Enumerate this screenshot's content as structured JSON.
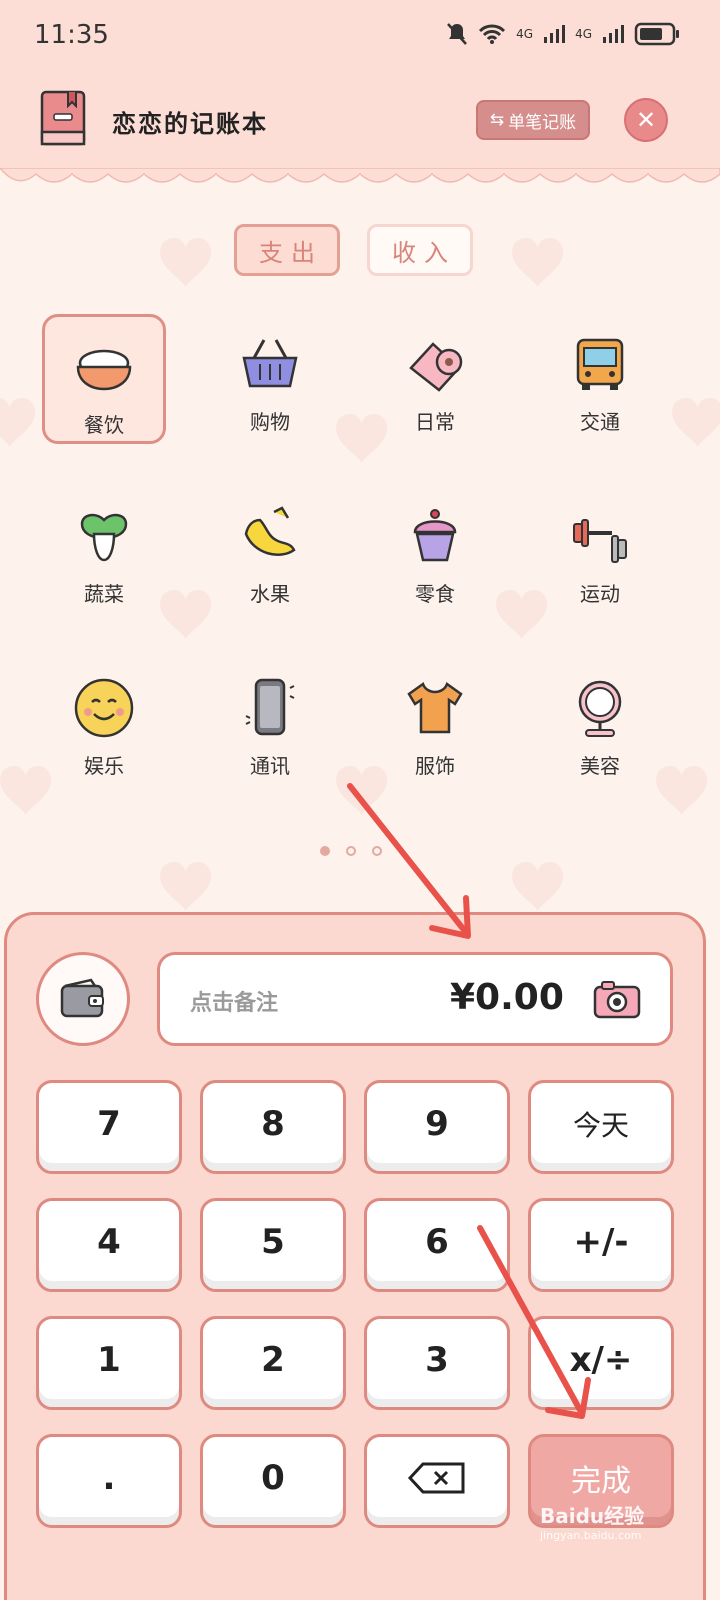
{
  "status_bar": {
    "time": "11:35",
    "signal_1": "4G",
    "signal_2": "4G"
  },
  "header": {
    "title": "恋恋的记账本",
    "single_button": "单笔记账",
    "single_icon": "swap-icon",
    "close_icon": "close-icon"
  },
  "tabs": [
    {
      "label": "支出",
      "active": true
    },
    {
      "label": "收入",
      "active": false
    }
  ],
  "categories": [
    {
      "label": "餐饮",
      "icon": "rice-bowl-icon",
      "selected": true
    },
    {
      "label": "购物",
      "icon": "basket-icon"
    },
    {
      "label": "日常",
      "icon": "toilet-paper-icon"
    },
    {
      "label": "交通",
      "icon": "bus-icon"
    },
    {
      "label": "蔬菜",
      "icon": "vegetable-icon"
    },
    {
      "label": "水果",
      "icon": "banana-icon"
    },
    {
      "label": "零食",
      "icon": "cupcake-icon"
    },
    {
      "label": "运动",
      "icon": "dumbbell-icon"
    },
    {
      "label": "娱乐",
      "icon": "smiley-icon"
    },
    {
      "label": "通讯",
      "icon": "phone-icon"
    },
    {
      "label": "服饰",
      "icon": "tshirt-icon"
    },
    {
      "label": "美容",
      "icon": "mirror-icon"
    }
  ],
  "pagination": {
    "pages": 3,
    "current": 1
  },
  "entry": {
    "note_placeholder": "点击备注",
    "amount": "¥0.00",
    "wallet_icon": "wallet-icon",
    "camera_icon": "camera-icon"
  },
  "keypad": {
    "k7": "7",
    "k8": "8",
    "k9": "9",
    "today": "今天",
    "k4": "4",
    "k5": "5",
    "k6": "6",
    "plus_minus": "+/-",
    "k1": "1",
    "k2": "2",
    "k3": "3",
    "times_div": "x/÷",
    "dot": ".",
    "k0": "0",
    "backspace_icon": "backspace-icon",
    "done": "完成"
  },
  "watermark": {
    "text": "Baidu经验",
    "sub": "jingyan.baidu.com"
  },
  "colors": {
    "header_bg": "#fcded6",
    "accent": "#de8a80",
    "panel_bg": "#fbd9d0",
    "done_bg": "#f0a8a5",
    "arrow": "#e8524a"
  }
}
